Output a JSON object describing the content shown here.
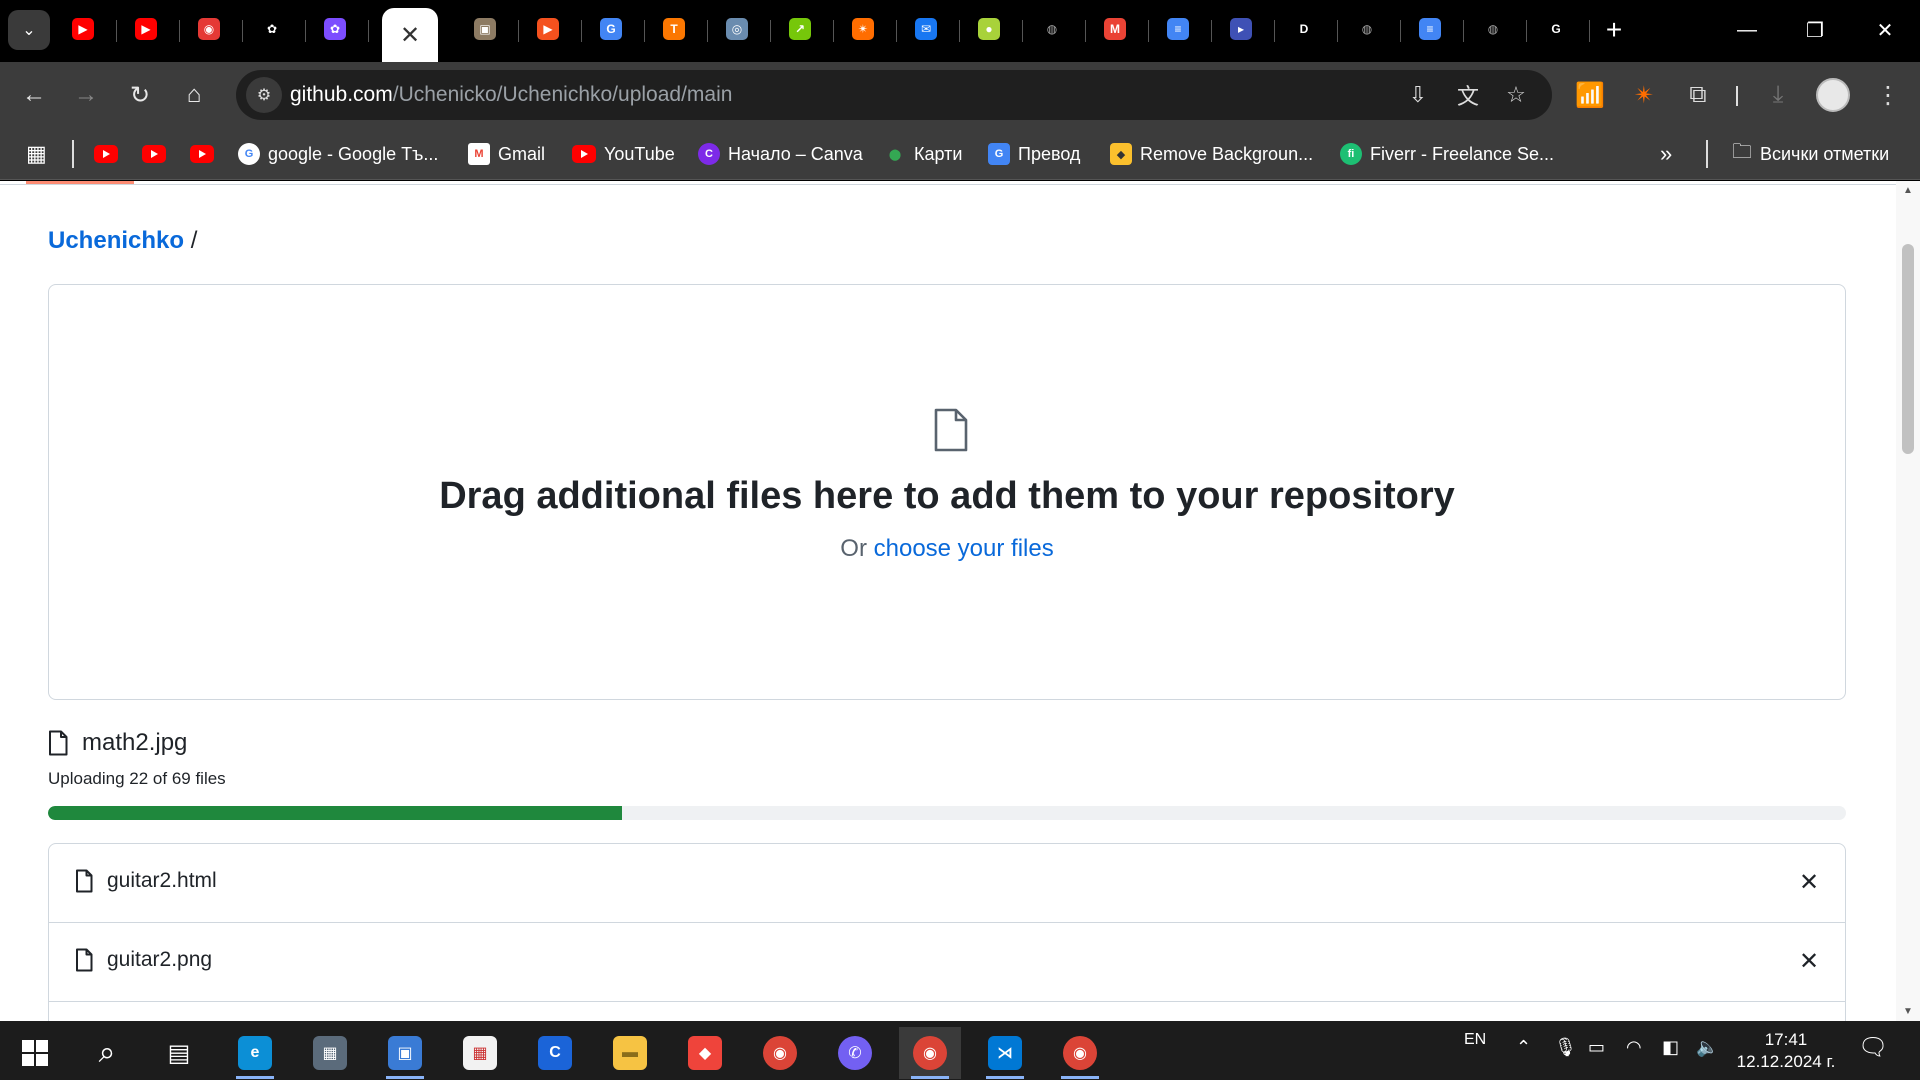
{
  "browser": {
    "tabs": [
      {
        "icon": "youtube-icon",
        "color": "#ff0000"
      },
      {
        "icon": "youtube-icon",
        "color": "#ff0000"
      },
      {
        "icon": "record-icon",
        "color": "#e53935"
      },
      {
        "icon": "chatgpt-icon",
        "color": "#ffffff"
      },
      {
        "icon": "ai-assistant-icon",
        "color": "#7c4dff"
      },
      {
        "icon": "close-icon",
        "active": true
      },
      {
        "icon": "image-thumbnail-icon",
        "color": "#8d7b63"
      },
      {
        "icon": "play-icon",
        "color": "#f4511e"
      },
      {
        "icon": "translate-icon",
        "color": "#4285f4"
      },
      {
        "icon": "temu-icon",
        "color": "#fb7701"
      },
      {
        "icon": "certificate-icon",
        "color": "#6a8caf"
      },
      {
        "icon": "chart-icon",
        "color": "#76c70a"
      },
      {
        "icon": "spark-icon",
        "color": "#ff6d00"
      },
      {
        "icon": "messenger-icon",
        "color": "#1877f2"
      },
      {
        "icon": "tennis-ball-icon",
        "color": "#a8d23a"
      },
      {
        "icon": "globe-icon",
        "color": "#9e9e9e"
      },
      {
        "icon": "gmail-icon",
        "color": "#ea4335"
      },
      {
        "icon": "docs-icon",
        "color": "#4285f4"
      },
      {
        "icon": "video-call-icon",
        "color": "#3f51b5"
      },
      {
        "icon": "d-logo-icon",
        "color": "#ffffff"
      },
      {
        "icon": "globe-icon",
        "color": "#9e9e9e"
      },
      {
        "icon": "docs-icon",
        "color": "#4285f4"
      },
      {
        "icon": "globe-icon",
        "color": "#9e9e9e"
      },
      {
        "icon": "google-icon",
        "color": "#ffffff"
      }
    ],
    "url_host": "github.com",
    "url_path": "/Uchenicko/Uchenichko/upload/main"
  },
  "bookmarks": {
    "items": [
      {
        "label": "",
        "icon": "youtube-icon"
      },
      {
        "label": "",
        "icon": "youtube-icon"
      },
      {
        "label": "",
        "icon": "youtube-icon"
      },
      {
        "label": "google - Google Тъ...",
        "icon": "google-icon"
      },
      {
        "label": "Gmail",
        "icon": "gmail-icon"
      },
      {
        "label": "YouTube",
        "icon": "youtube-icon"
      },
      {
        "label": "Начало – Canva",
        "icon": "canva-icon"
      },
      {
        "label": "Карти",
        "icon": "maps-pin-icon"
      },
      {
        "label": "Превод",
        "icon": "translate-icon"
      },
      {
        "label": "Remove Backgroun...",
        "icon": "remove-bg-icon"
      },
      {
        "label": "Fiverr - Freelance Se...",
        "icon": "fiverr-icon"
      }
    ],
    "more": "»",
    "all_bookmarks": "Всички отметки"
  },
  "page": {
    "breadcrumb_repo": "Uchenichko",
    "breadcrumb_sep": "/",
    "drop_title": "Drag additional files here to add them to your repository",
    "drop_or": "Or",
    "drop_choose": "choose your files",
    "current_file": "math2.jpg",
    "upload_status": "Uploading 22 of 69 files",
    "upload_progress": {
      "done": 22,
      "total": 69,
      "fraction": 0.319
    },
    "files": [
      {
        "name": "guitar2.html"
      },
      {
        "name": "guitar2.png"
      }
    ]
  },
  "taskbar": {
    "language": "EN",
    "time": "17:41",
    "date": "12.12.2024 г."
  },
  "colors": {
    "link": "#0969da",
    "progress_fill": "#1f883d",
    "progress_track": "#eff1f3",
    "border": "#d0d7de"
  }
}
